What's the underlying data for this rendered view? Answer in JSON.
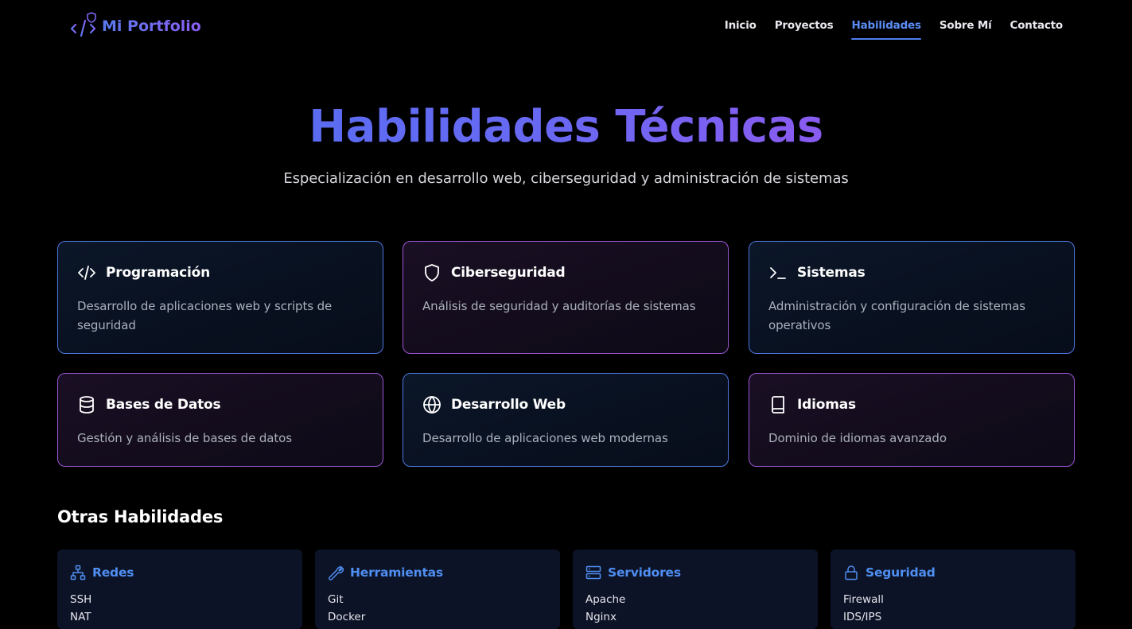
{
  "nav": {
    "brand": "Mi Portfolio",
    "links": [
      {
        "label": "Inicio",
        "active": false
      },
      {
        "label": "Proyectos",
        "active": false
      },
      {
        "label": "Habilidades",
        "active": true
      },
      {
        "label": "Sobre Mí",
        "active": false
      },
      {
        "label": "Contacto",
        "active": false
      }
    ]
  },
  "hero": {
    "title": "Habilidades Técnicas",
    "subtitle": "Especialización en desarrollo web, ciberseguridad y administración de sistemas"
  },
  "cards": [
    {
      "title": "Programación",
      "description": "Desarrollo de aplicaciones web y scripts de seguridad",
      "icon": "code-icon",
      "style": "blue"
    },
    {
      "title": "Ciberseguridad",
      "description": "Análisis de seguridad y auditorías de sistemas",
      "icon": "shield-icon",
      "style": "purple"
    },
    {
      "title": "Sistemas",
      "description": "Administración y configuración de sistemas operativos",
      "icon": "terminal-icon",
      "style": "blue"
    },
    {
      "title": "Bases de Datos",
      "description": "Gestión y análisis de bases de datos",
      "icon": "database-icon",
      "style": "purple"
    },
    {
      "title": "Desarrollo Web",
      "description": "Desarrollo de aplicaciones web modernas",
      "icon": "globe-icon",
      "style": "blue"
    },
    {
      "title": "Idiomas",
      "description": "Dominio de idiomas avanzado",
      "icon": "book-icon",
      "style": "purple"
    }
  ],
  "other": {
    "title": "Otras Habilidades",
    "groups": [
      {
        "title": "Redes",
        "icon": "network-icon",
        "items": [
          "SSH",
          "NAT"
        ]
      },
      {
        "title": "Herramientas",
        "icon": "wrench-icon",
        "items": [
          "Git",
          "Docker"
        ]
      },
      {
        "title": "Servidores",
        "icon": "server-icon",
        "items": [
          "Apache",
          "Nginx"
        ]
      },
      {
        "title": "Seguridad",
        "icon": "lock-icon",
        "items": [
          "Firewall",
          "IDS/IPS"
        ]
      }
    ]
  },
  "colors": {
    "accent_blue": "#4f8ef2",
    "accent_purple": "#8a5bf0",
    "card_border_blue": "#4d77df",
    "card_border_purple": "#9b55d4",
    "background": "#000000"
  }
}
